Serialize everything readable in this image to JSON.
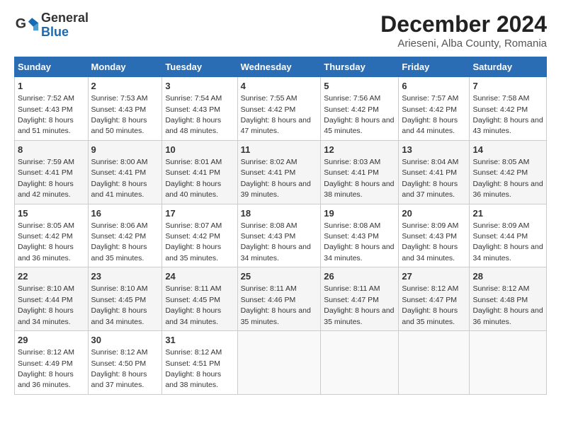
{
  "logo": {
    "general": "General",
    "blue": "Blue"
  },
  "title": "December 2024",
  "subtitle": "Arieseni, Alba County, Romania",
  "days": [
    "Sunday",
    "Monday",
    "Tuesday",
    "Wednesday",
    "Thursday",
    "Friday",
    "Saturday"
  ],
  "weeks": [
    [
      {
        "day": "1",
        "sunrise": "7:52 AM",
        "sunset": "4:43 PM",
        "daylight": "8 hours and 51 minutes."
      },
      {
        "day": "2",
        "sunrise": "7:53 AM",
        "sunset": "4:43 PM",
        "daylight": "8 hours and 50 minutes."
      },
      {
        "day": "3",
        "sunrise": "7:54 AM",
        "sunset": "4:43 PM",
        "daylight": "8 hours and 48 minutes."
      },
      {
        "day": "4",
        "sunrise": "7:55 AM",
        "sunset": "4:42 PM",
        "daylight": "8 hours and 47 minutes."
      },
      {
        "day": "5",
        "sunrise": "7:56 AM",
        "sunset": "4:42 PM",
        "daylight": "8 hours and 45 minutes."
      },
      {
        "day": "6",
        "sunrise": "7:57 AM",
        "sunset": "4:42 PM",
        "daylight": "8 hours and 44 minutes."
      },
      {
        "day": "7",
        "sunrise": "7:58 AM",
        "sunset": "4:42 PM",
        "daylight": "8 hours and 43 minutes."
      }
    ],
    [
      {
        "day": "8",
        "sunrise": "7:59 AM",
        "sunset": "4:41 PM",
        "daylight": "8 hours and 42 minutes."
      },
      {
        "day": "9",
        "sunrise": "8:00 AM",
        "sunset": "4:41 PM",
        "daylight": "8 hours and 41 minutes."
      },
      {
        "day": "10",
        "sunrise": "8:01 AM",
        "sunset": "4:41 PM",
        "daylight": "8 hours and 40 minutes."
      },
      {
        "day": "11",
        "sunrise": "8:02 AM",
        "sunset": "4:41 PM",
        "daylight": "8 hours and 39 minutes."
      },
      {
        "day": "12",
        "sunrise": "8:03 AM",
        "sunset": "4:41 PM",
        "daylight": "8 hours and 38 minutes."
      },
      {
        "day": "13",
        "sunrise": "8:04 AM",
        "sunset": "4:41 PM",
        "daylight": "8 hours and 37 minutes."
      },
      {
        "day": "14",
        "sunrise": "8:05 AM",
        "sunset": "4:42 PM",
        "daylight": "8 hours and 36 minutes."
      }
    ],
    [
      {
        "day": "15",
        "sunrise": "8:05 AM",
        "sunset": "4:42 PM",
        "daylight": "8 hours and 36 minutes."
      },
      {
        "day": "16",
        "sunrise": "8:06 AM",
        "sunset": "4:42 PM",
        "daylight": "8 hours and 35 minutes."
      },
      {
        "day": "17",
        "sunrise": "8:07 AM",
        "sunset": "4:42 PM",
        "daylight": "8 hours and 35 minutes."
      },
      {
        "day": "18",
        "sunrise": "8:08 AM",
        "sunset": "4:43 PM",
        "daylight": "8 hours and 34 minutes."
      },
      {
        "day": "19",
        "sunrise": "8:08 AM",
        "sunset": "4:43 PM",
        "daylight": "8 hours and 34 minutes."
      },
      {
        "day": "20",
        "sunrise": "8:09 AM",
        "sunset": "4:43 PM",
        "daylight": "8 hours and 34 minutes."
      },
      {
        "day": "21",
        "sunrise": "8:09 AM",
        "sunset": "4:44 PM",
        "daylight": "8 hours and 34 minutes."
      }
    ],
    [
      {
        "day": "22",
        "sunrise": "8:10 AM",
        "sunset": "4:44 PM",
        "daylight": "8 hours and 34 minutes."
      },
      {
        "day": "23",
        "sunrise": "8:10 AM",
        "sunset": "4:45 PM",
        "daylight": "8 hours and 34 minutes."
      },
      {
        "day": "24",
        "sunrise": "8:11 AM",
        "sunset": "4:45 PM",
        "daylight": "8 hours and 34 minutes."
      },
      {
        "day": "25",
        "sunrise": "8:11 AM",
        "sunset": "4:46 PM",
        "daylight": "8 hours and 35 minutes."
      },
      {
        "day": "26",
        "sunrise": "8:11 AM",
        "sunset": "4:47 PM",
        "daylight": "8 hours and 35 minutes."
      },
      {
        "day": "27",
        "sunrise": "8:12 AM",
        "sunset": "4:47 PM",
        "daylight": "8 hours and 35 minutes."
      },
      {
        "day": "28",
        "sunrise": "8:12 AM",
        "sunset": "4:48 PM",
        "daylight": "8 hours and 36 minutes."
      }
    ],
    [
      {
        "day": "29",
        "sunrise": "8:12 AM",
        "sunset": "4:49 PM",
        "daylight": "8 hours and 36 minutes."
      },
      {
        "day": "30",
        "sunrise": "8:12 AM",
        "sunset": "4:50 PM",
        "daylight": "8 hours and 37 minutes."
      },
      {
        "day": "31",
        "sunrise": "8:12 AM",
        "sunset": "4:51 PM",
        "daylight": "8 hours and 38 minutes."
      },
      null,
      null,
      null,
      null
    ]
  ]
}
